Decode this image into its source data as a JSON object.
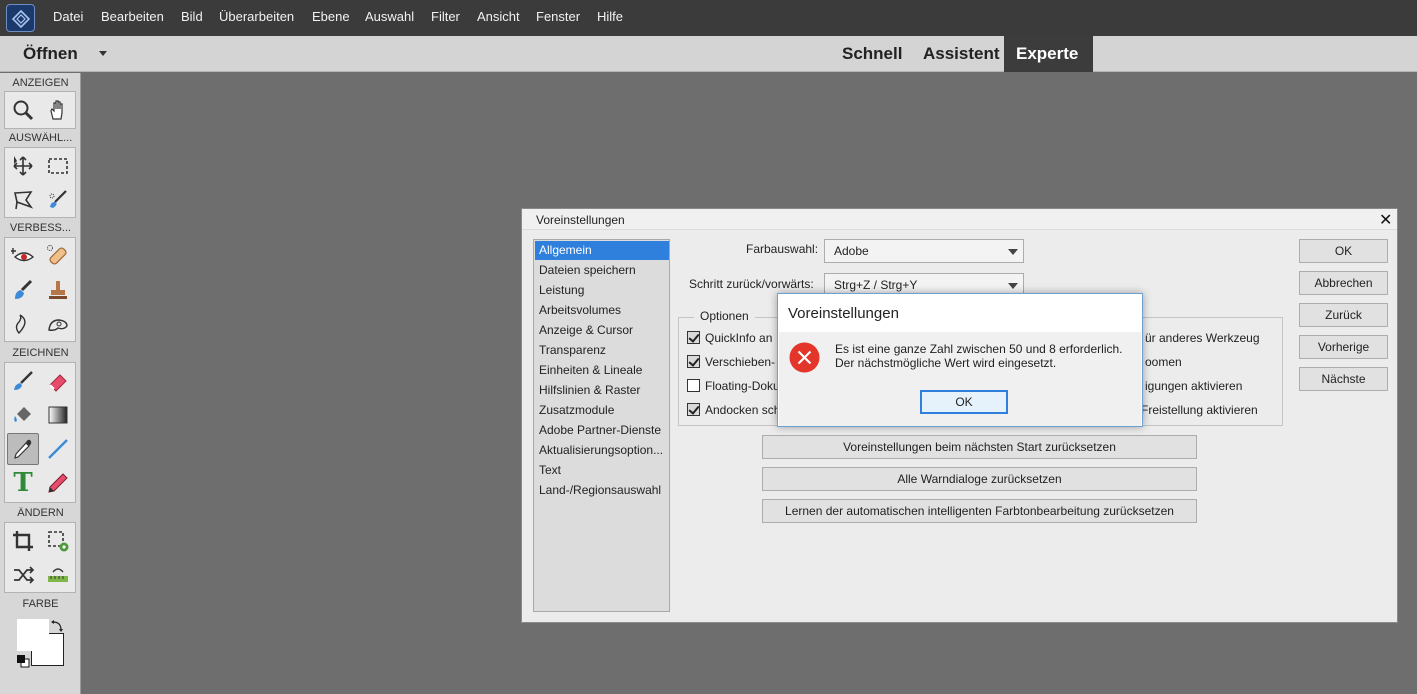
{
  "menubar": {
    "items": [
      "Datei",
      "Bearbeiten",
      "Bild",
      "Überarbeiten",
      "Ebene",
      "Auswahl",
      "Filter",
      "Ansicht",
      "Fenster",
      "Hilfe"
    ]
  },
  "modebar": {
    "open_label": "Öffnen",
    "tabs": [
      {
        "label": "Schnell",
        "active": false
      },
      {
        "label": "Assistent",
        "active": false
      },
      {
        "label": "Experte",
        "active": true
      }
    ]
  },
  "toolbox": {
    "sections": [
      "ANZEIGEN",
      "AUSWÄHL...",
      "VERBESS...",
      "ZEICHNEN",
      "ÄNDERN",
      "FARBE"
    ],
    "colors": {
      "foreground": "#ffffff",
      "background": "#ffffff"
    }
  },
  "prefs_dialog": {
    "title": "Voreinstellungen",
    "categories": [
      "Allgemein",
      "Dateien speichern",
      "Leistung",
      "Arbeitsvolumes",
      "Anzeige & Cursor",
      "Transparenz",
      "Einheiten & Lineale",
      "Hilfslinien & Raster",
      "Zusatzmodule",
      "Adobe Partner-Dienste",
      "Aktualisierungsoption...",
      "Text",
      "Land-/Regionsauswahl"
    ],
    "selected_category": "Allgemein",
    "color_picker_label": "Farbauswahl:",
    "color_picker_value": "Adobe",
    "step_label": "Schritt zurück/vorwärts:",
    "step_value": "Strg+Z / Strg+Y",
    "options_title": "Optionen",
    "options_left": [
      {
        "label": "QuickInfo an",
        "checked": true
      },
      {
        "label": "Verschieben-",
        "checked": true
      },
      {
        "label": "Floating-Doku",
        "checked": false
      },
      {
        "label": "Andocken sch",
        "checked": true
      }
    ],
    "options_right": [
      "ür anderes Werkzeug",
      "oomen",
      "igungen aktivieren",
      "Freistellung aktivieren"
    ],
    "reset_prefs_label": "Voreinstellungen beim nächsten Start zurücksetzen",
    "reset_warnings_label": "Alle Warndialoge zurücksetzen",
    "reset_learning_label": "Lernen der automatischen intelligenten Farbtonbearbeitung zurücksetzen",
    "buttons": {
      "ok": "OK",
      "cancel": "Abbrechen",
      "back": "Zurück",
      "previous": "Vorherige",
      "next": "Nächste"
    }
  },
  "error_dialog": {
    "title": "Voreinstellungen",
    "line1": "Es ist eine ganze Zahl zwischen 50 und 8 erforderlich.",
    "line2": "Der nächstmögliche Wert wird eingesetzt.",
    "ok": "OK"
  }
}
